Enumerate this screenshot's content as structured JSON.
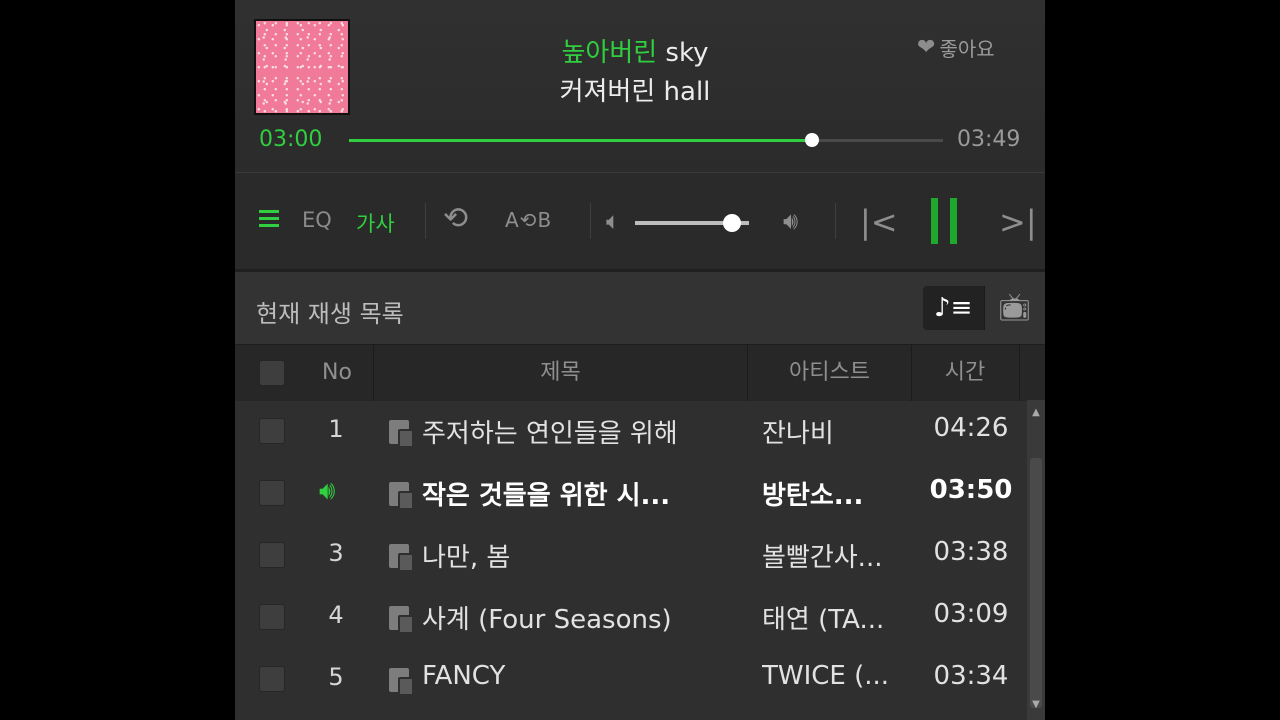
{
  "now_playing": {
    "lyric_line1_highlight": "높아버린",
    "lyric_line1_rest": " sky",
    "lyric_line2": "커져버린 hall",
    "like_label": "좋아요",
    "current_time": "03:00",
    "total_time": "03:49",
    "progress": 0.78
  },
  "controls": {
    "eq_label": "EQ",
    "lyrics_label": "가사",
    "ab_label": "A⟲B",
    "volume": 0.85
  },
  "playlist": {
    "title": "현재 재생 목록",
    "columns": {
      "no": "No",
      "title": "제목",
      "artist": "아티스트",
      "time": "시간"
    },
    "rows": [
      {
        "no": "1",
        "title": "주저하는 연인들을 위해",
        "artist": "잔나비",
        "time": "04:26"
      },
      {
        "no": "",
        "title": "작은 것들을 위한 시...",
        "artist": "방탄소...",
        "time": "03:50"
      },
      {
        "no": "3",
        "title": "나만, 봄",
        "artist": "볼빨간사...",
        "time": "03:38"
      },
      {
        "no": "4",
        "title": "사계 (Four Seasons)",
        "artist": "태연 (TA...",
        "time": "03:09"
      },
      {
        "no": "5",
        "title": "FANCY",
        "artist": "TWICE (...",
        "time": "03:34"
      }
    ]
  },
  "colors": {
    "accent": "#2fcf3f",
    "background": "#2f2f2f"
  }
}
